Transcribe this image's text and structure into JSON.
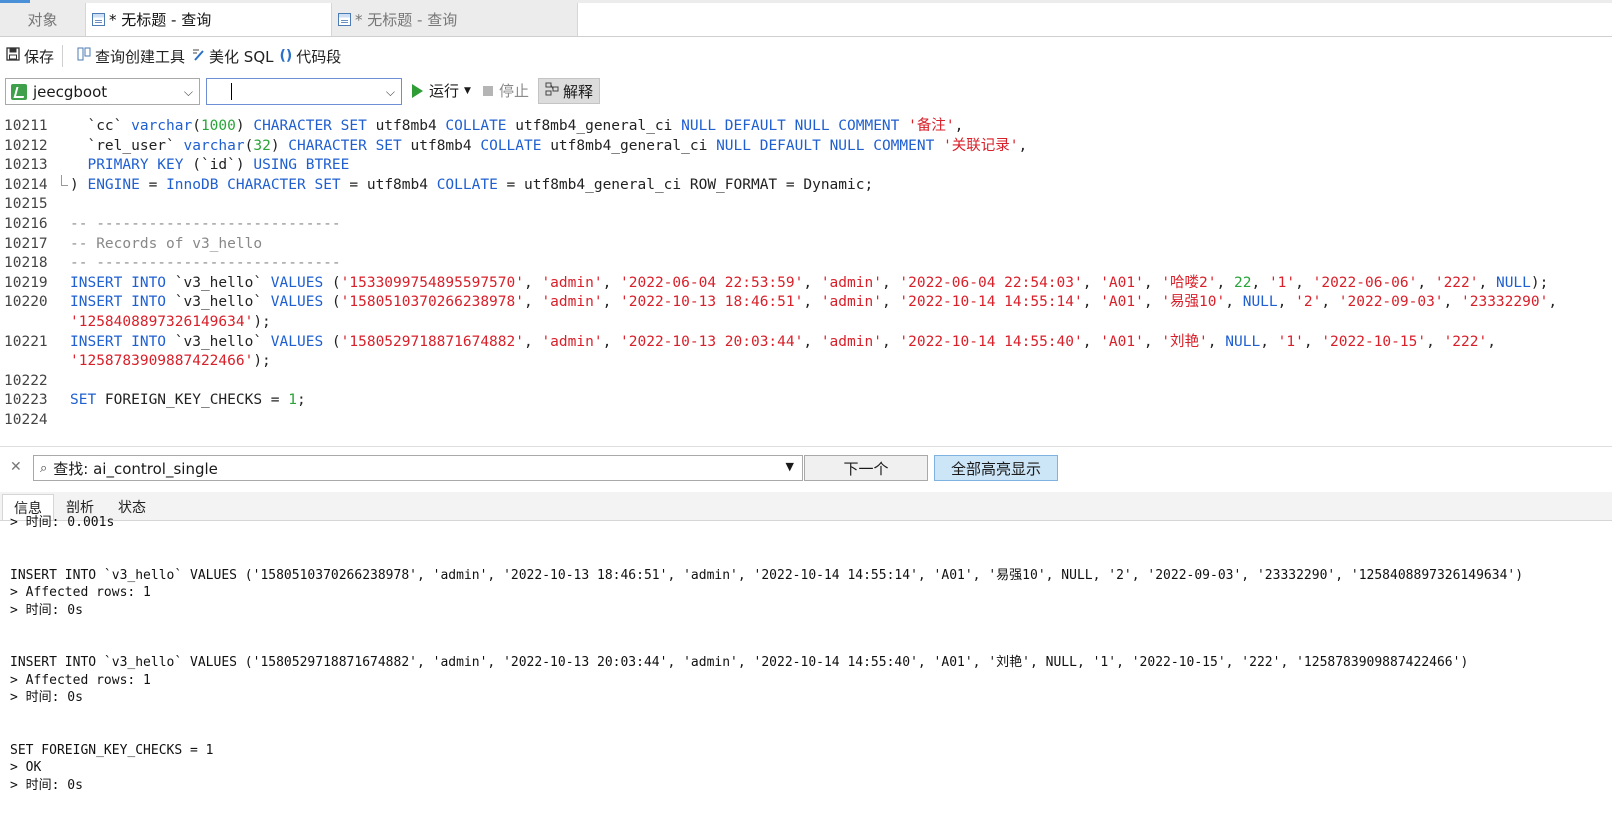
{
  "tabs": {
    "objects": "对象",
    "active": "* 无标题 - 查询",
    "inactive": "* 无标题 - 查询"
  },
  "toolbar": {
    "save": "保存",
    "query_builder": "查询创建工具",
    "beautify": "美化 SQL",
    "snippet": "代码段"
  },
  "runbar": {
    "database": "jeecgboot",
    "schema": "",
    "run": "运行",
    "stop": "停止",
    "explain": "解释"
  },
  "editor": {
    "lines": [
      {
        "num": "10211",
        "tokens": [
          [
            "pl",
            "  `cc` "
          ],
          [
            "kw",
            "varchar"
          ],
          [
            "pl",
            "("
          ],
          [
            "num",
            "1000"
          ],
          [
            "pl",
            ") "
          ],
          [
            "kw",
            "CHARACTER SET"
          ],
          [
            "pl",
            " utf8mb4 "
          ],
          [
            "kw",
            "COLLATE"
          ],
          [
            "pl",
            " utf8mb4_general_ci "
          ],
          [
            "kw",
            "NULL DEFAULT NULL COMMENT"
          ],
          [
            "pl",
            " "
          ],
          [
            "str",
            "'备注'"
          ],
          [
            "pl",
            ","
          ]
        ]
      },
      {
        "num": "10212",
        "tokens": [
          [
            "pl",
            "  `rel_user` "
          ],
          [
            "kw",
            "varchar"
          ],
          [
            "pl",
            "("
          ],
          [
            "num",
            "32"
          ],
          [
            "pl",
            ") "
          ],
          [
            "kw",
            "CHARACTER SET"
          ],
          [
            "pl",
            " utf8mb4 "
          ],
          [
            "kw",
            "COLLATE"
          ],
          [
            "pl",
            " utf8mb4_general_ci "
          ],
          [
            "kw",
            "NULL DEFAULT NULL COMMENT"
          ],
          [
            "pl",
            " "
          ],
          [
            "str",
            "'关联记录'"
          ],
          [
            "pl",
            ","
          ]
        ]
      },
      {
        "num": "10213",
        "tokens": [
          [
            "pl",
            "  "
          ],
          [
            "kw",
            "PRIMARY KEY"
          ],
          [
            "pl",
            " (`id`) "
          ],
          [
            "kw",
            "USING BTREE"
          ]
        ]
      },
      {
        "num": "10214",
        "fold": true,
        "tokens": [
          [
            "pl",
            ") "
          ],
          [
            "kw",
            "ENGINE"
          ],
          [
            "pl",
            " = "
          ],
          [
            "kw",
            "InnoDB CHARACTER SET"
          ],
          [
            "pl",
            " = utf8mb4 "
          ],
          [
            "kw",
            "COLLATE"
          ],
          [
            "pl",
            " = utf8mb4_general_ci ROW_FORMAT = Dynamic;"
          ]
        ]
      },
      {
        "num": "10215",
        "tokens": []
      },
      {
        "num": "10216",
        "tokens": [
          [
            "cm",
            "-- ----------------------------"
          ]
        ]
      },
      {
        "num": "10217",
        "tokens": [
          [
            "cm",
            "-- Records of v3_hello"
          ]
        ]
      },
      {
        "num": "10218",
        "tokens": [
          [
            "cm",
            "-- ----------------------------"
          ]
        ]
      },
      {
        "num": "10219",
        "tokens": [
          [
            "kw",
            "INSERT INTO"
          ],
          [
            "pl",
            " `v3_hello` "
          ],
          [
            "kw",
            "VALUES"
          ],
          [
            "pl",
            " ("
          ],
          [
            "str",
            "'1533099754895597570'"
          ],
          [
            "pl",
            ", "
          ],
          [
            "str",
            "'admin'"
          ],
          [
            "pl",
            ", "
          ],
          [
            "str",
            "'2022-06-04 22:53:59'"
          ],
          [
            "pl",
            ", "
          ],
          [
            "str",
            "'admin'"
          ],
          [
            "pl",
            ", "
          ],
          [
            "str",
            "'2022-06-04 22:54:03'"
          ],
          [
            "pl",
            ", "
          ],
          [
            "str",
            "'A01'"
          ],
          [
            "pl",
            ", "
          ],
          [
            "str",
            "'哈喽2'"
          ],
          [
            "pl",
            ", "
          ],
          [
            "num",
            "22"
          ],
          [
            "pl",
            ", "
          ],
          [
            "str",
            "'1'"
          ],
          [
            "pl",
            ", "
          ],
          [
            "str",
            "'2022-06-06'"
          ],
          [
            "pl",
            ", "
          ],
          [
            "str",
            "'222'"
          ],
          [
            "pl",
            ", "
          ],
          [
            "kw",
            "NULL"
          ],
          [
            "pl",
            ");"
          ]
        ]
      },
      {
        "num": "10220",
        "tokens": [
          [
            "kw",
            "INSERT INTO"
          ],
          [
            "pl",
            " `v3_hello` "
          ],
          [
            "kw",
            "VALUES"
          ],
          [
            "pl",
            " ("
          ],
          [
            "str",
            "'1580510370266238978'"
          ],
          [
            "pl",
            ", "
          ],
          [
            "str",
            "'admin'"
          ],
          [
            "pl",
            ", "
          ],
          [
            "str",
            "'2022-10-13 18:46:51'"
          ],
          [
            "pl",
            ", "
          ],
          [
            "str",
            "'admin'"
          ],
          [
            "pl",
            ", "
          ],
          [
            "str",
            "'2022-10-14 14:55:14'"
          ],
          [
            "pl",
            ", "
          ],
          [
            "str",
            "'A01'"
          ],
          [
            "pl",
            ", "
          ],
          [
            "str",
            "'易强10'"
          ],
          [
            "pl",
            ", "
          ],
          [
            "kw",
            "NULL"
          ],
          [
            "pl",
            ", "
          ],
          [
            "str",
            "'2'"
          ],
          [
            "pl",
            ", "
          ],
          [
            "str",
            "'2022-09-03'"
          ],
          [
            "pl",
            ", "
          ],
          [
            "str",
            "'23332290'"
          ],
          [
            "pl",
            ","
          ]
        ]
      },
      {
        "num": "",
        "tokens": [
          [
            "str",
            "'1258408897326149634'"
          ],
          [
            "pl",
            ");"
          ]
        ]
      },
      {
        "num": "10221",
        "tokens": [
          [
            "kw",
            "INSERT INTO"
          ],
          [
            "pl",
            " `v3_hello` "
          ],
          [
            "kw",
            "VALUES"
          ],
          [
            "pl",
            " ("
          ],
          [
            "str",
            "'1580529718871674882'"
          ],
          [
            "pl",
            ", "
          ],
          [
            "str",
            "'admin'"
          ],
          [
            "pl",
            ", "
          ],
          [
            "str",
            "'2022-10-13 20:03:44'"
          ],
          [
            "pl",
            ", "
          ],
          [
            "str",
            "'admin'"
          ],
          [
            "pl",
            ", "
          ],
          [
            "str",
            "'2022-10-14 14:55:40'"
          ],
          [
            "pl",
            ", "
          ],
          [
            "str",
            "'A01'"
          ],
          [
            "pl",
            ", "
          ],
          [
            "str",
            "'刘艳'"
          ],
          [
            "pl",
            ", "
          ],
          [
            "kw",
            "NULL"
          ],
          [
            "pl",
            ", "
          ],
          [
            "str",
            "'1'"
          ],
          [
            "pl",
            ", "
          ],
          [
            "str",
            "'2022-10-15'"
          ],
          [
            "pl",
            ", "
          ],
          [
            "str",
            "'222'"
          ],
          [
            "pl",
            ","
          ]
        ]
      },
      {
        "num": "",
        "tokens": [
          [
            "str",
            "'1258783909887422466'"
          ],
          [
            "pl",
            ");"
          ]
        ]
      },
      {
        "num": "10222",
        "tokens": []
      },
      {
        "num": "10223",
        "tokens": [
          [
            "kw",
            "SET"
          ],
          [
            "pl",
            " FOREIGN_KEY_CHECKS = "
          ],
          [
            "num",
            "1"
          ],
          [
            "pl",
            ";"
          ]
        ]
      },
      {
        "num": "10224",
        "tokens": []
      }
    ]
  },
  "find": {
    "label": "查找: ai_control_single",
    "next": "下一个",
    "highlight_all": "全部高亮显示"
  },
  "result_tabs": [
    "信息",
    "剖析",
    "状态"
  ],
  "output": {
    "lines": [
      "> 时间: 0.001s",
      "",
      "",
      "INSERT INTO `v3_hello` VALUES ('1580510370266238978', 'admin', '2022-10-13 18:46:51', 'admin', '2022-10-14 14:55:14', 'A01', '易强10', NULL, '2', '2022-09-03', '23332290', '1258408897326149634')",
      "> Affected rows: 1",
      "> 时间: 0s",
      "",
      "",
      "INSERT INTO `v3_hello` VALUES ('1580529718871674882', 'admin', '2022-10-13 20:03:44', 'admin', '2022-10-14 14:55:40', 'A01', '刘艳', NULL, '1', '2022-10-15', '222', '1258783909887422466')",
      "> Affected rows: 1",
      "> 时间: 0s",
      "",
      "",
      "SET FOREIGN_KEY_CHECKS = 1",
      "> OK",
      "> 时间: 0s"
    ]
  },
  "colors": {
    "keyword": "#1f5fd0",
    "string": "#d8202a",
    "number": "#2aa43a",
    "comment": "#888888",
    "run_icon": "#2e9d36",
    "highlight_button": "#cde6f7"
  }
}
